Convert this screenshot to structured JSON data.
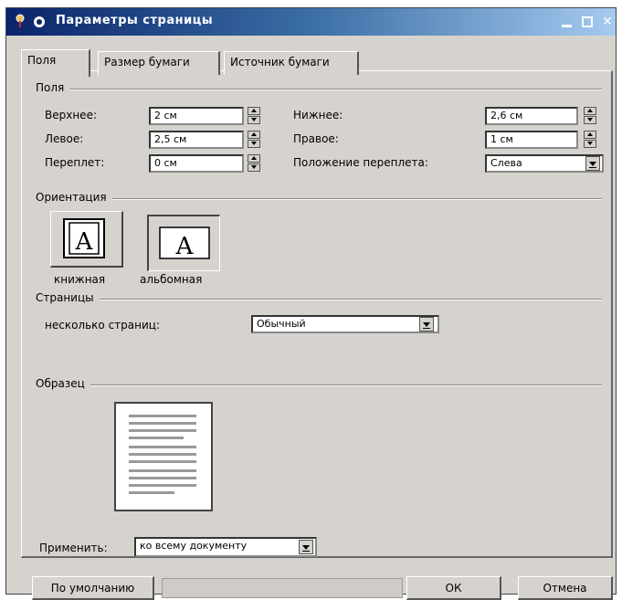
{
  "window": {
    "title": "Параметры страницы",
    "colors": {
      "titlebar_start": "#0a246a",
      "titlebar_end": "#a6caf0",
      "face": "#d6d3ce"
    }
  },
  "tabs": [
    {
      "label": "Поля",
      "active": true
    },
    {
      "label": "Размер бумаги",
      "active": false
    },
    {
      "label": "Источник бумаги",
      "active": false
    }
  ],
  "margins": {
    "group_label": "Поля",
    "top_label": "Верхнее:",
    "top_value": "2 см",
    "left_label": "Левое:",
    "left_value": "2,5 см",
    "gutter_label": "Переплет:",
    "gutter_value": "0 см",
    "bottom_label": "Нижнее:",
    "bottom_value": "2,6 см",
    "right_label": "Правое:",
    "right_value": "1 см",
    "gutter_pos_label": "Положение переплета:",
    "gutter_pos_value": "Слева"
  },
  "orientation": {
    "group_label": "Ориентация",
    "portrait_label": "книжная",
    "landscape_label": "альбомная",
    "selected": "portrait",
    "glyph": "A"
  },
  "pages": {
    "group_label": "Страницы",
    "multiple_label": "несколько страниц:",
    "multiple_value": "Обычный"
  },
  "sample": {
    "group_label": "Образец",
    "apply_label": "Применить:",
    "apply_value": "ко всему документу"
  },
  "buttons": {
    "default_label": "По умолчанию",
    "ok_label": "ОК",
    "cancel_label": "Отмена"
  }
}
